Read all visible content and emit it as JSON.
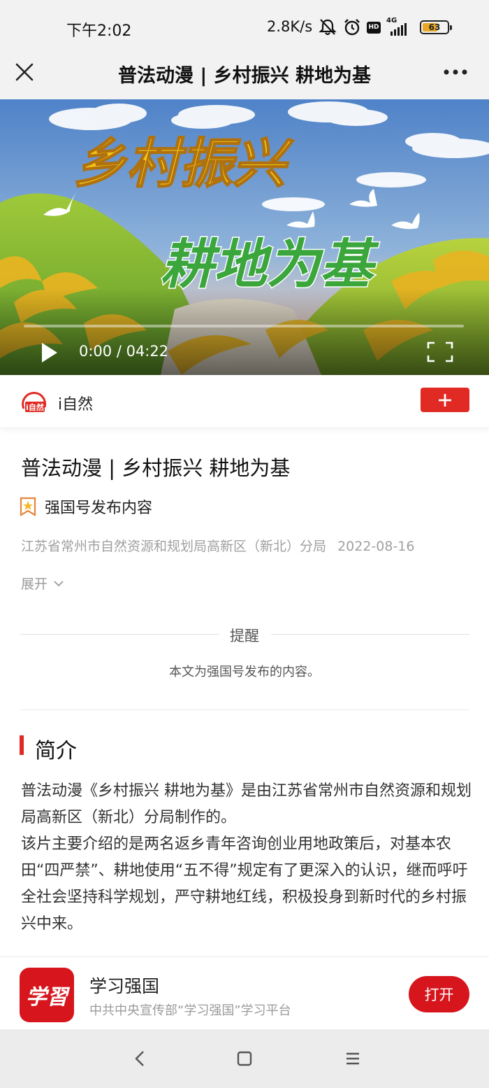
{
  "status_bar": {
    "time": "下午2:02",
    "network_speed": "2.8K/s",
    "icons": [
      "mute-bell-icon",
      "alarm-icon",
      "hd-icon",
      "signal-4g-icon",
      "battery-icon"
    ],
    "hd_label": "HD",
    "network_type": "4G",
    "battery_level": "63",
    "battery_fraction": 0.63
  },
  "title_bar": {
    "title": "普法动漫 | 乡村振兴 耕地为基",
    "close_icon": "close-icon",
    "more_icon": "more-horizontal-icon"
  },
  "video": {
    "poster_line1": "乡村振兴",
    "poster_line2": "耕地为基",
    "current_time": "0:00",
    "duration": "04:22",
    "time_display": "0:00 / 04:22",
    "progress_fraction": 0.0,
    "play_icon": "play-icon",
    "fullscreen_icon": "fullscreen-icon"
  },
  "publisher": {
    "logo_text": "i自然",
    "name": "i自然",
    "follow_icon": "plus-icon"
  },
  "article": {
    "title": "普法动漫 | 乡村振兴 耕地为基",
    "source_label": "强国号发布内容",
    "source_icon": "star-badge-icon",
    "author": "江苏省常州市自然资源和规划局高新区（新北）分局",
    "date": "2022-08-16",
    "expand_label": "展开",
    "expand_icon": "chevron-down-icon"
  },
  "notice": {
    "title": "提醒",
    "text": "本文为强国号发布的内容。"
  },
  "intro": {
    "heading": "简介",
    "paragraphs": [
      "普法动漫《乡村振兴 耕地为基》是由江苏省常州市自然资源和规划局高新区（新北）分局制作的。",
      "该片主要介绍的是两名返乡青年咨询创业用地政策后，对基本农田“四严禁”、耕地使用“五不得”规定有了更深入的认识，继而呼吁全社会坚持科学规划，严守耕地红线，积极投身到新时代的乡村振兴中来。"
    ]
  },
  "app_banner": {
    "logo_text": "学習",
    "name": "学习强国",
    "description": "中共中央宣传部“学习强国”学习平台",
    "open_label": "打开"
  },
  "nav_bar": {
    "icons": [
      "back-icon",
      "home-icon",
      "menu-icon"
    ]
  },
  "colors": {
    "accent_red": "#e02a23",
    "app_red": "#d7151d",
    "poster_yellow": "#f2c617",
    "poster_green": "#3aa63b",
    "battery_yellow": "#e9a825"
  }
}
